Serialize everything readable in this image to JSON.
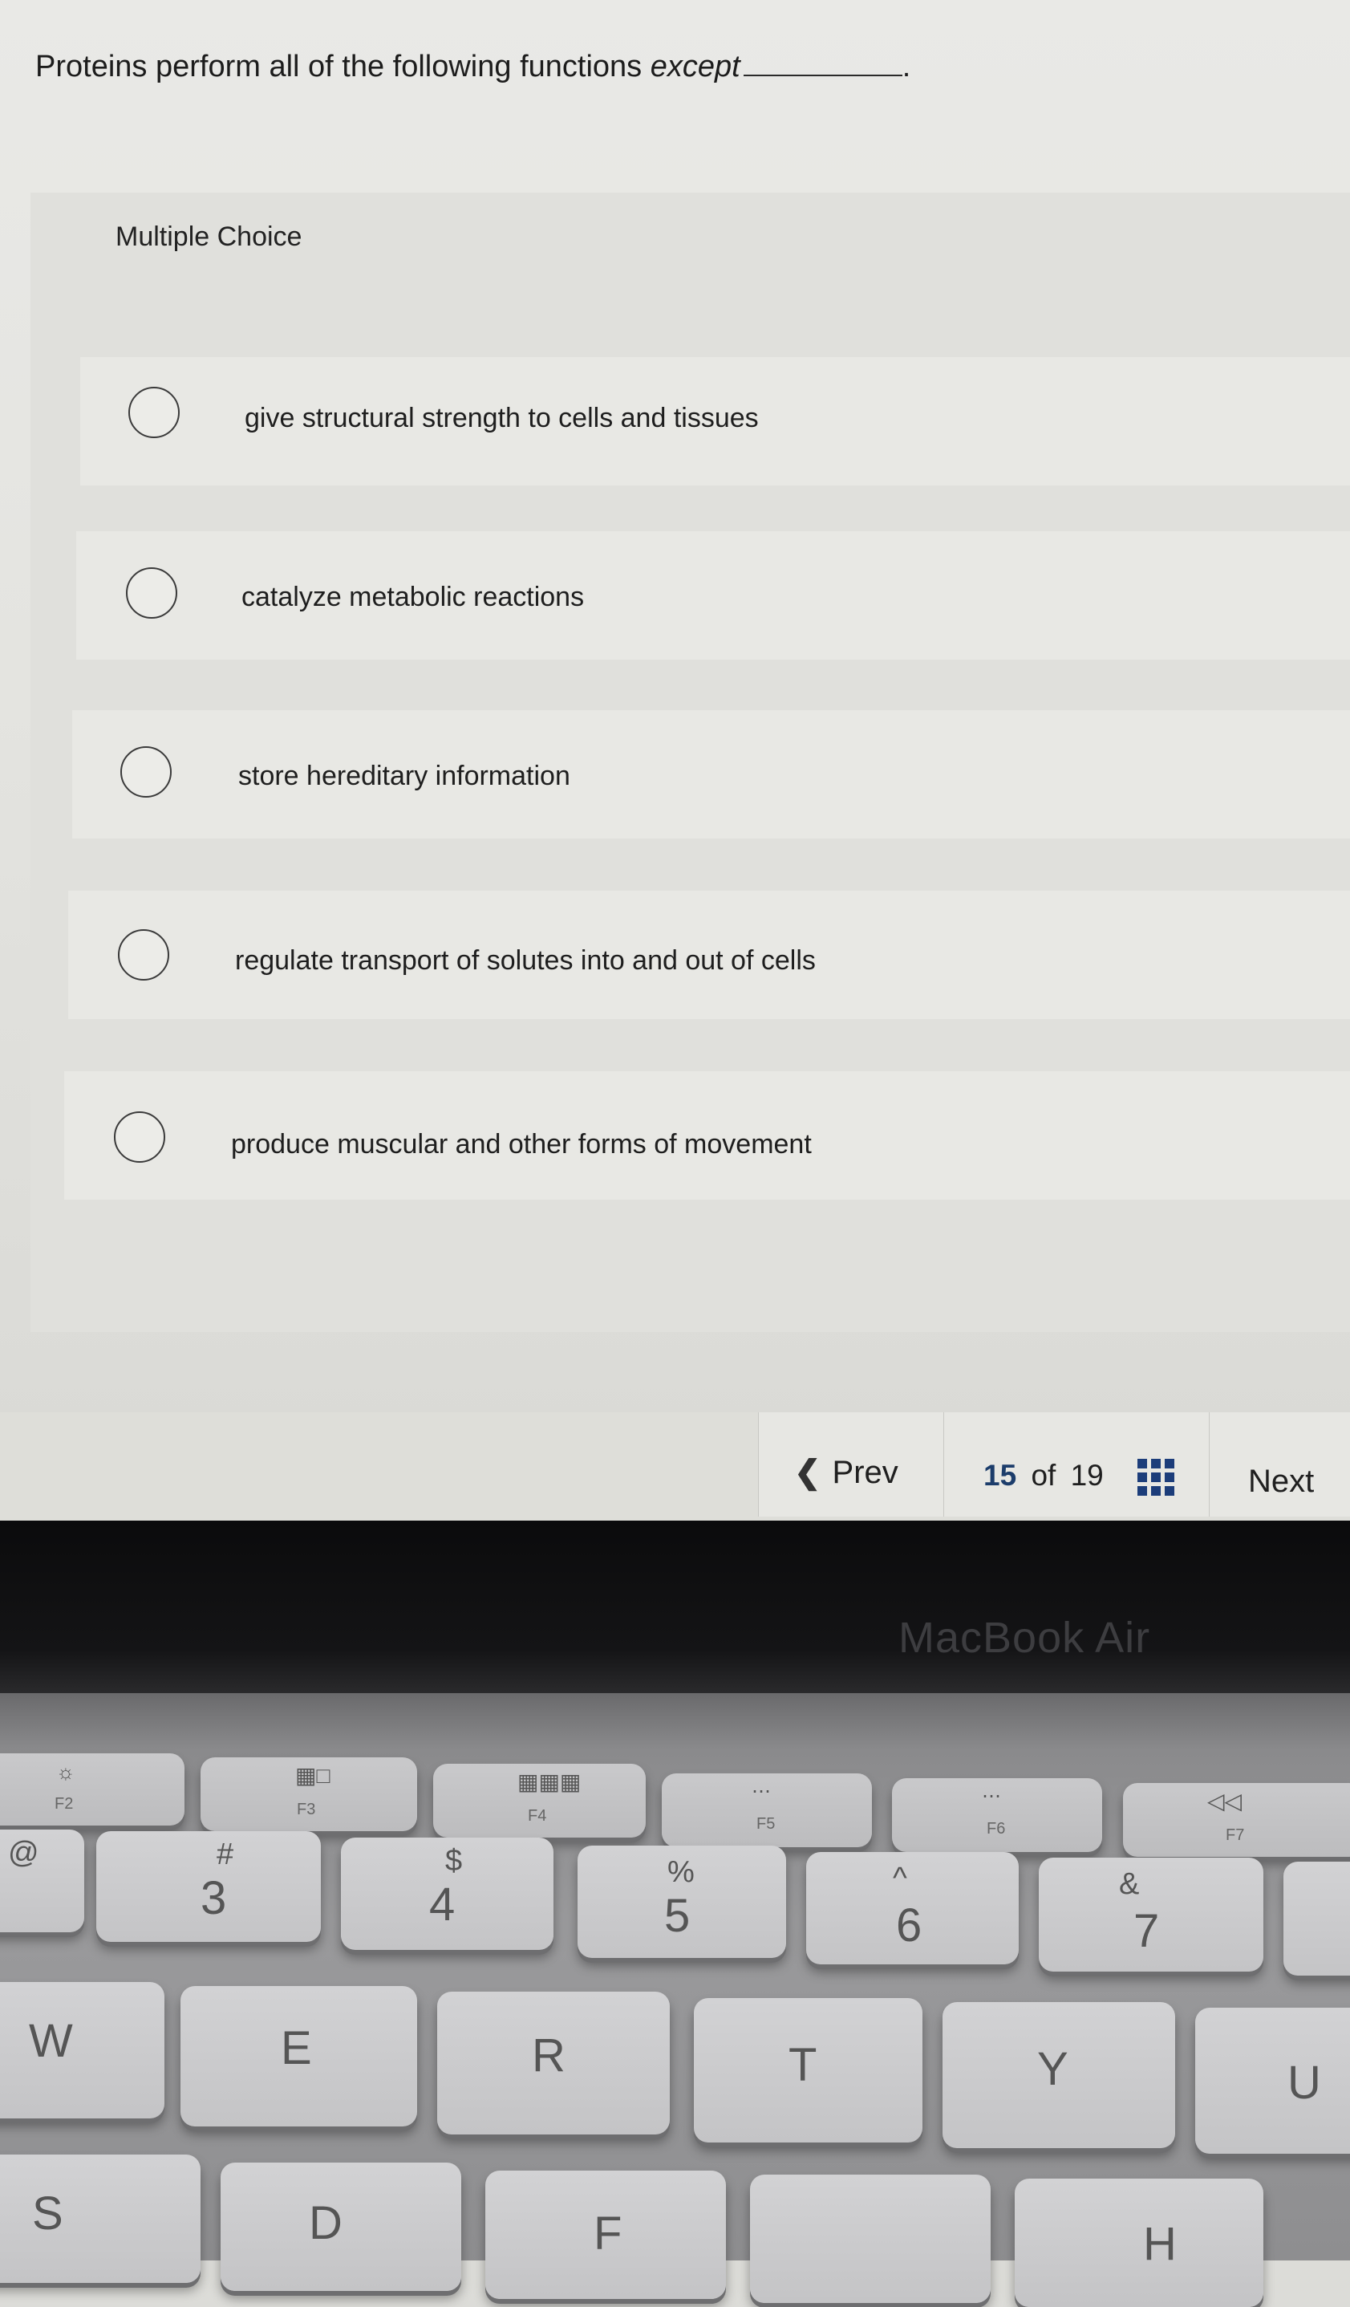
{
  "question": {
    "text": "Proteins perform all of the following functions",
    "emphasis": "except",
    "end": "."
  },
  "section_label": "Multiple Choice",
  "options": [
    "give structural strength to cells and tissues",
    "catalyze metabolic reactions",
    "store hereditary information",
    "regulate transport of solutes into and out of cells",
    "produce muscular and other forms of movement"
  ],
  "nav": {
    "prev_label": "Prev",
    "current_page": "15",
    "of_label": "of",
    "total_pages": "19",
    "next_label": "Next",
    "grid_icon": "grid-icon",
    "accent_color": "#1c3d7a"
  },
  "laptop": {
    "brand": "MacBook Air",
    "fkeys": [
      "F2",
      "F3",
      "F4",
      "F5",
      "F6",
      "F7"
    ],
    "number_row": [
      {
        "main": "3",
        "shift": "#"
      },
      {
        "main": "4",
        "shift": "$"
      },
      {
        "main": "5",
        "shift": "%"
      },
      {
        "main": "6",
        "shift": "^"
      },
      {
        "main": "7",
        "shift": "&"
      }
    ],
    "letter_row": [
      "W",
      "E",
      "R",
      "T",
      "Y",
      "U"
    ],
    "partial_keys": [
      "@",
      "S",
      "D",
      "F",
      "H"
    ]
  }
}
